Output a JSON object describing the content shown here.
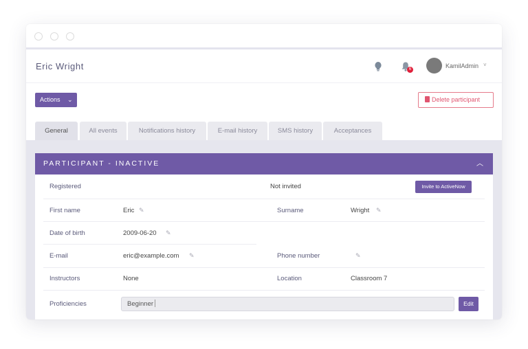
{
  "header": {
    "title": "Eric Wright",
    "notification_count": "6",
    "user_name": "KamilAdmin",
    "user_caret": "˅"
  },
  "toolbar": {
    "actions_label": "Actions",
    "actions_caret": "⌄",
    "delete_label": "Delete participant"
  },
  "tabs": [
    {
      "label": "General",
      "active": true
    },
    {
      "label": "All events",
      "active": false
    },
    {
      "label": "Notifications history",
      "active": false
    },
    {
      "label": "E-mail history",
      "active": false
    },
    {
      "label": "SMS history",
      "active": false
    },
    {
      "label": "Acceptances",
      "active": false
    }
  ],
  "panel": {
    "title": "PARTICIPANT - INACTIVE",
    "collapse_glyph": "︿",
    "registered_label": "Registered",
    "invitation_status": "Not invited",
    "invite_button": "Invite to ActiveNow",
    "first_name_label": "First name",
    "first_name": "Eric",
    "surname_label": "Surname",
    "surname": "Wright",
    "dob_label": "Date of birth",
    "dob": "2009-06-20",
    "email_label": "E-mail",
    "email": "eric@example.com",
    "phone_label": "Phone number",
    "phone": "",
    "instructors_label": "Instructors",
    "instructors": "None",
    "location_label": "Location",
    "location": "Classroom 7",
    "proficiencies_label": "Proficiencies",
    "proficiencies": "Beginner",
    "edit_button": "Edit"
  },
  "colors": {
    "accent": "#6f5aa6",
    "danger": "#e05570",
    "badge": "#e0203a"
  }
}
